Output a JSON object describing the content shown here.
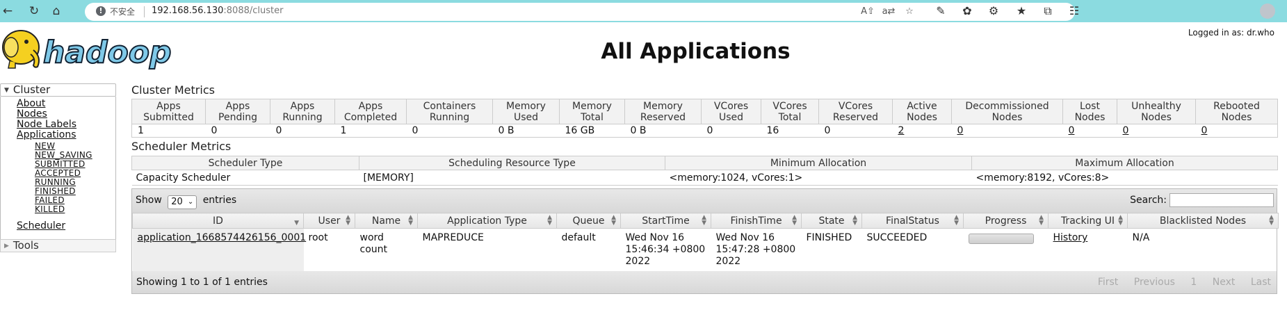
{
  "browser": {
    "insecure_label": "不安全",
    "url_host": "192.168.56.130",
    "url_rest": ":8088/cluster"
  },
  "header": {
    "title": "All Applications",
    "logged_in": "Logged in as: dr.who",
    "logo_text": "hadoop"
  },
  "sidebar": {
    "cluster_label": "Cluster",
    "links": [
      "About",
      "Nodes",
      "Node Labels",
      "Applications"
    ],
    "app_states": [
      "NEW",
      "NEW_SAVING",
      "SUBMITTED",
      "ACCEPTED",
      "RUNNING",
      "FINISHED",
      "FAILED",
      "KILLED"
    ],
    "scheduler": "Scheduler",
    "tools_label": "Tools"
  },
  "cluster_metrics": {
    "title": "Cluster Metrics",
    "headers": [
      [
        "Apps",
        "Submitted"
      ],
      [
        "Apps",
        "Pending"
      ],
      [
        "Apps",
        "Running"
      ],
      [
        "Apps",
        "Completed"
      ],
      [
        "Containers",
        "Running"
      ],
      [
        "Memory",
        "Used"
      ],
      [
        "Memory",
        "Total"
      ],
      [
        "Memory",
        "Reserved"
      ],
      [
        "VCores",
        "Used"
      ],
      [
        "VCores",
        "Total"
      ],
      [
        "VCores",
        "Reserved"
      ],
      [
        "Active",
        "Nodes"
      ],
      [
        "Decommissioned",
        "Nodes"
      ],
      [
        "Lost",
        "Nodes"
      ],
      [
        "Unhealthy",
        "Nodes"
      ],
      [
        "Rebooted",
        "Nodes"
      ]
    ],
    "values": [
      "1",
      "0",
      "0",
      "1",
      "0",
      "0 B",
      "16 GB",
      "0 B",
      "0",
      "16",
      "0",
      "2",
      "0",
      "0",
      "0",
      "0"
    ]
  },
  "scheduler_metrics": {
    "title": "Scheduler Metrics",
    "headers": [
      "Scheduler Type",
      "Scheduling Resource Type",
      "Minimum Allocation",
      "Maximum Allocation"
    ],
    "values": [
      "Capacity Scheduler",
      "[MEMORY]",
      "<memory:1024, vCores:1>",
      "<memory:8192, vCores:8>"
    ]
  },
  "apps_table": {
    "show_label": "Show",
    "page_length": "20",
    "entries_label": "entries",
    "search_label": "Search:",
    "search_value": "",
    "headers": [
      "ID",
      "User",
      "Name",
      "Application Type",
      "Queue",
      "StartTime",
      "FinishTime",
      "State",
      "FinalStatus",
      "Progress",
      "Tracking UI",
      "Blacklisted Nodes"
    ],
    "rows": [
      {
        "id": "application_1668574426156_0001",
        "user": "root",
        "name": "word count",
        "type": "MAPREDUCE",
        "queue": "default",
        "start": "Wed Nov 16 15:46:34 +0800 2022",
        "finish": "Wed Nov 16 15:47:28 +0800 2022",
        "state": "FINISHED",
        "final_status": "SUCCEEDED",
        "progress": 0,
        "tracking": "History",
        "blacklisted": "N/A"
      }
    ],
    "showing": "Showing 1 to 1 of 1 entries",
    "pager": [
      "First",
      "Previous",
      "1",
      "Next",
      "Last"
    ]
  },
  "colors": {
    "browser_bar": "#8bdbe0",
    "logo_fill": "#7fc9e8",
    "elephant": "#f5d020"
  }
}
